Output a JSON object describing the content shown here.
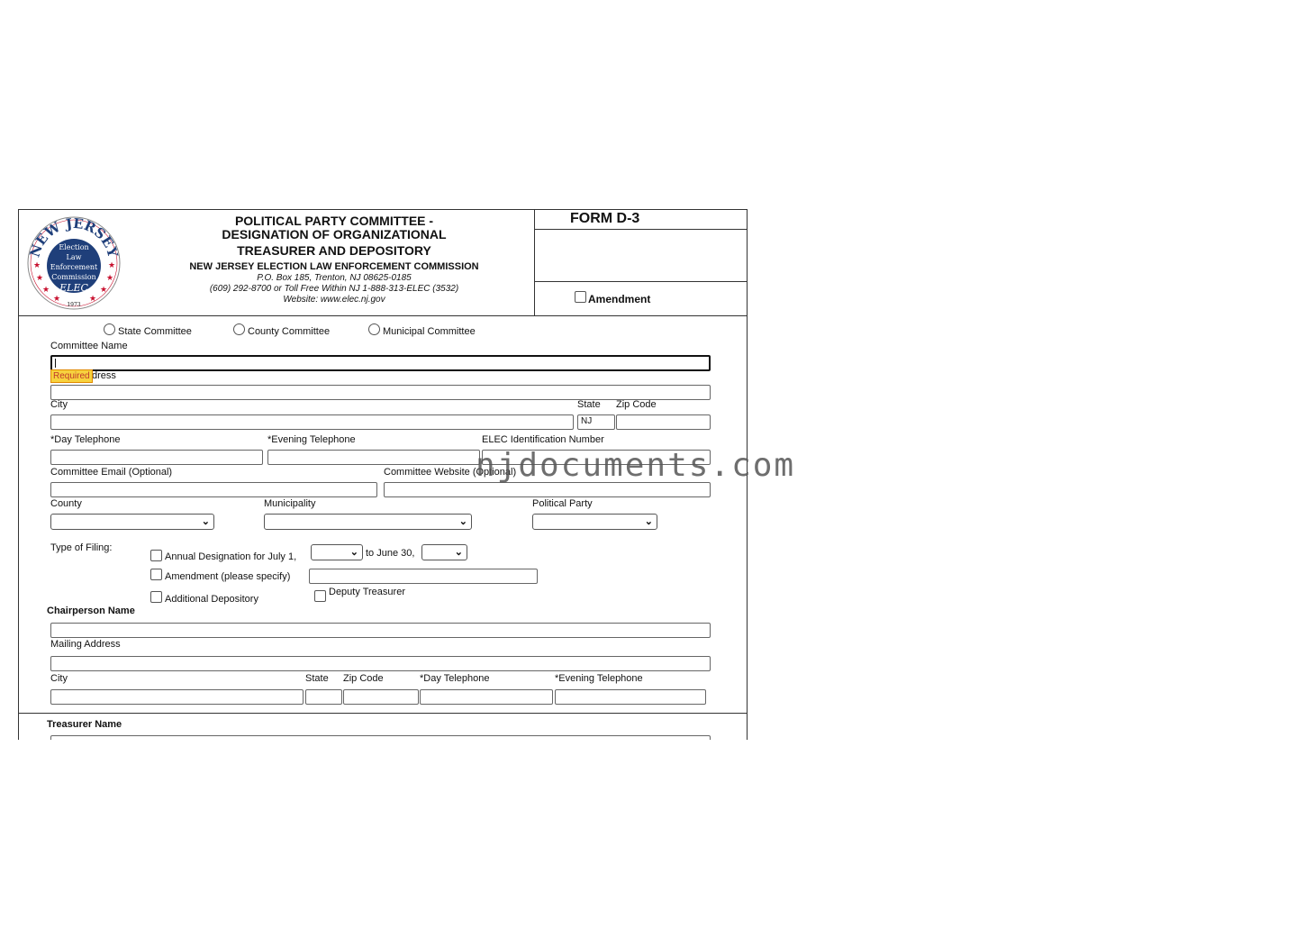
{
  "header": {
    "logo": {
      "arc_text": "NEW JERSEY",
      "inner_lines": [
        "Election",
        "Law",
        "Enforcement",
        "Commission"
      ],
      "abbrev": "ELEC",
      "year": "1973"
    },
    "title_lines": [
      "POLITICAL PARTY COMMITTEE -",
      "DESIGNATION OF ORGANIZATIONAL",
      "TREASURER AND DEPOSITORY"
    ],
    "agency": "NEW JERSEY ELECTION LAW ENFORCEMENT COMMISSION",
    "address": "P.O. Box 185, Trenton, NJ 08625-0185",
    "phone": "(609) 292-8700 or Toll Free Within NJ 1-888-313-ELEC (3532)",
    "website": "Website: www.elec.nj.gov",
    "form_id": "FORM D-3",
    "amendment_label": "Amendment"
  },
  "committee_type": {
    "options": [
      "State Committee",
      "County Committee",
      "Municipal Committee"
    ]
  },
  "committee": {
    "name_label": "Committee Name",
    "required_tooltip": "Required",
    "address_label_partial": "dress",
    "city_label": "City",
    "state_label": "State",
    "state_value": "NJ",
    "zip_label": "Zip Code",
    "day_phone_label": "*Day Telephone",
    "evening_phone_label": "*Evening Telephone",
    "elec_id_label": "ELEC Identification Number",
    "email_label": "Committee Email (Optional)",
    "website_label": "Committee Website (Optional)",
    "county_label": "County",
    "municipality_label": "Municipality",
    "party_label": "Political Party"
  },
  "filing": {
    "type_label": "Type of Filing:",
    "annual_label": "Annual Designation for July 1,",
    "to_label": "to June 30,",
    "amendment_label": "Amendment (please specify)",
    "additional_label": "Additional Depository",
    "deputy_label": "Deputy Treasurer"
  },
  "chairperson": {
    "section_label": "Chairperson Name",
    "mailing_label": "Mailing Address",
    "city_label": "City",
    "state_label": "State",
    "zip_label": "Zip Code",
    "day_phone_label": "*Day Telephone",
    "evening_phone_label": "*Evening Telephone"
  },
  "treasurer": {
    "section_label": "Treasurer Name"
  },
  "watermark": "njdocuments.com",
  "colors": {
    "logo_blue": "#1f3f7a",
    "logo_red": "#c8102e",
    "tooltip_bg": "#f7d23e",
    "tooltip_text": "#c0392b",
    "focus_border": "#111111"
  }
}
